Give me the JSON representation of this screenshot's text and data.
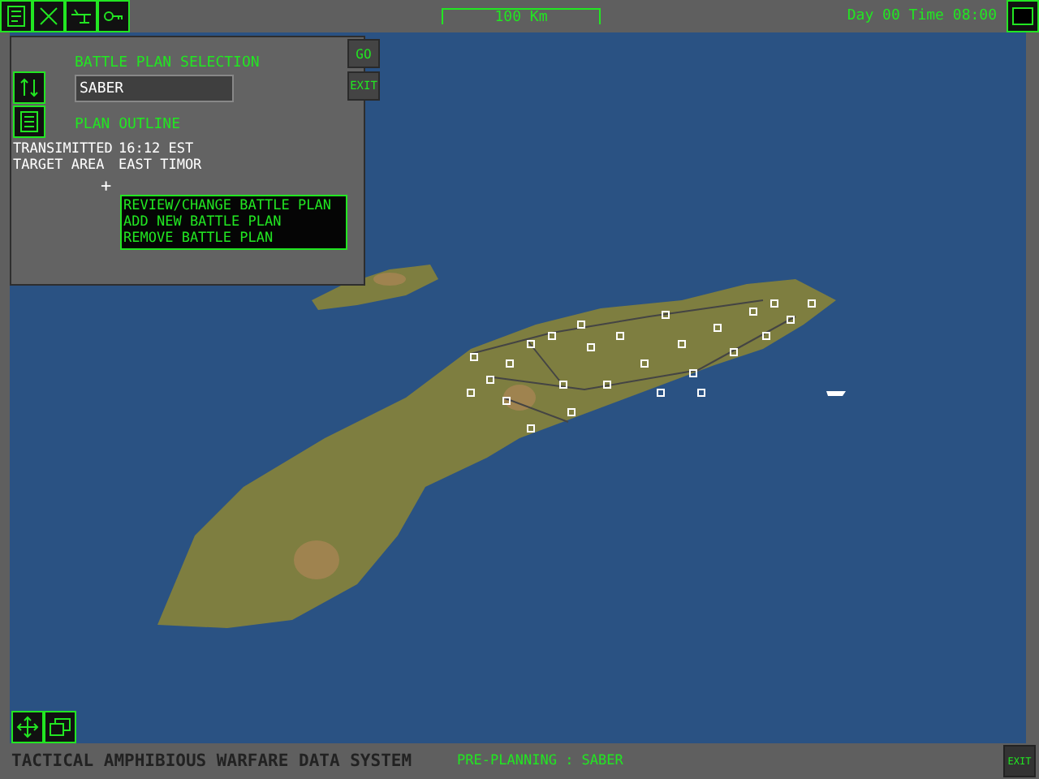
{
  "top_bar": {
    "scale": "100 Km",
    "clock": "Day 00 Time 08:00"
  },
  "panel": {
    "title": "BATTLE PLAN SELECTION",
    "selection": "SABER",
    "go": "GO",
    "exit": "EXIT",
    "outline_title": "PLAN OUTLINE",
    "outline": [
      {
        "label": "TRANSIMITTED",
        "value": "16:12 EST"
      },
      {
        "label": "TARGET AREA",
        "value": "EAST TIMOR"
      }
    ],
    "cursor": "+",
    "menu": [
      "REVIEW/CHANGE BATTLE PLAN",
      "ADD NEW BATTLE PLAN",
      "REMOVE BATTLE PLAN"
    ]
  },
  "status_bar": {
    "title": "TACTICAL AMPHIBIOUS WARFARE DATA SYSTEM",
    "mode": "PRE-PLANNING : SABER",
    "exit": "EXIT"
  }
}
